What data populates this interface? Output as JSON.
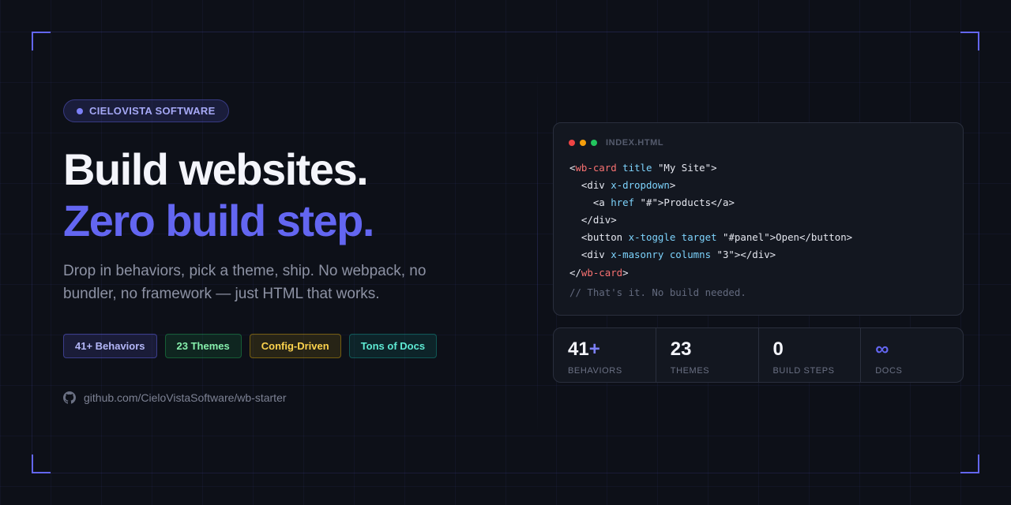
{
  "badge": {
    "label": "CIELOVISTA SOFTWARE"
  },
  "hero": {
    "title_line1": "Build websites.",
    "title_line2": "Zero build step.",
    "subtitle": "Drop in behaviors, pick a theme, ship. No webpack, no bundler, no framework — just HTML that works."
  },
  "pills": [
    {
      "label": "41+ Behaviors"
    },
    {
      "label": "23 Themes"
    },
    {
      "label": "Config-Driven"
    },
    {
      "label": "Tons of Docs"
    }
  ],
  "github": {
    "icon": "github-icon",
    "link": "github.com/CieloVistaSoftware/wb-starter"
  },
  "code_window": {
    "file_name": "INDEX.HTML",
    "dot_colors": [
      "#ef4444",
      "#f59e0b",
      "#22c55e"
    ],
    "comment": "// That's it. No build needed."
  },
  "stats": [
    {
      "number": "41",
      "suffix": "+",
      "label": "BEHAVIORS"
    },
    {
      "number": "23",
      "suffix": "",
      "label": "THEMES"
    },
    {
      "number": "0",
      "suffix": "",
      "label": "BUILD STEPS"
    },
    {
      "number": "∞",
      "suffix": "",
      "label": "DOCS"
    }
  ],
  "colors": {
    "accent": "#6366f1",
    "background": "#0d1018",
    "card": "#131720"
  }
}
